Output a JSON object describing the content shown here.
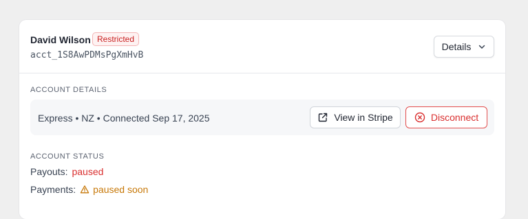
{
  "account": {
    "name": "David Wilson",
    "status_badge": "Restricted",
    "id": "acct_1S8AwPDMsPgXmHvB",
    "details_button": "Details"
  },
  "account_details": {
    "heading": "ACCOUNT DETAILS",
    "summary": "Express • NZ • Connected Sep 17, 2025",
    "view_button": "View in Stripe",
    "disconnect_button": "Disconnect"
  },
  "account_status": {
    "heading": "ACCOUNT STATUS",
    "payouts_label": "Payouts:",
    "payouts_value": "paused",
    "payments_label": "Payments:",
    "payments_value": "paused soon"
  },
  "colors": {
    "danger": "#d92d2d",
    "warning": "#c77808",
    "badge_bg": "#fef2f2"
  },
  "icons": [
    "chevron-down-icon",
    "external-link-icon",
    "x-circle-icon",
    "warning-triangle-icon"
  ]
}
